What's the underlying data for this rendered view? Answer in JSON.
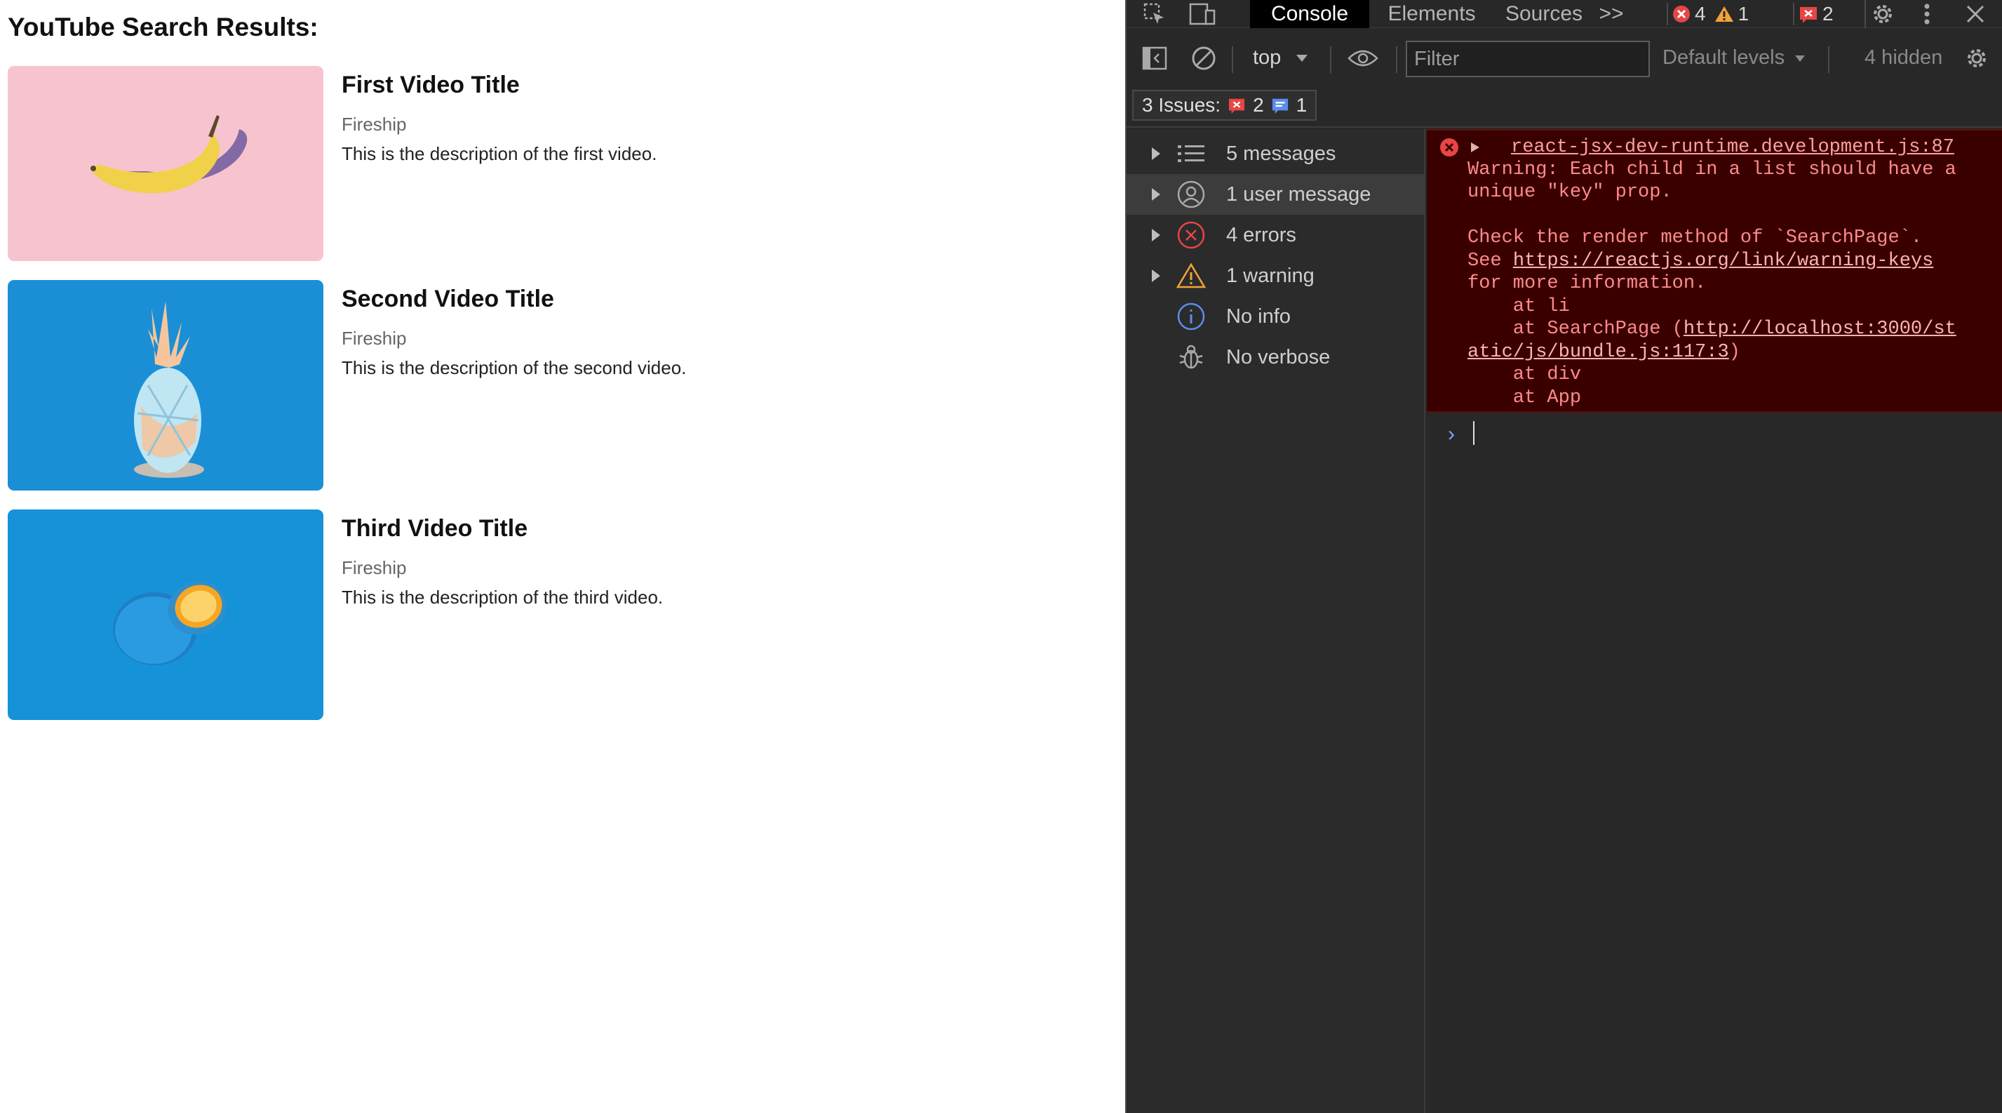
{
  "page": {
    "heading": "YouTube Search Results:",
    "videos": [
      {
        "title": "First Video Title",
        "channel": "Fireship",
        "description": "This is the description of the first video.",
        "thumb_bg": "#f7c3cf"
      },
      {
        "title": "Second Video Title",
        "channel": "Fireship",
        "description": "This is the description of the second video.",
        "thumb_bg": "#1a8fd6"
      },
      {
        "title": "Third Video Title",
        "channel": "Fireship",
        "description": "This is the description of the third video.",
        "thumb_bg": "#1692d8"
      }
    ]
  },
  "devtools": {
    "tabs": {
      "console": "Console",
      "elements": "Elements",
      "sources": "Sources",
      "more": ">>"
    },
    "badges": {
      "errors": "4",
      "warnings": "1",
      "issues": "2"
    },
    "toolbar": {
      "context": "top",
      "filter_placeholder": "Filter",
      "levels": "Default levels",
      "hidden": "4 hidden"
    },
    "issues_bar": {
      "label": "3 Issues:",
      "errors": "2",
      "info": "1"
    },
    "sidebar": [
      {
        "label": "5 messages",
        "icon": "list-icon"
      },
      {
        "label": "1 user message",
        "icon": "user-icon"
      },
      {
        "label": "4 errors",
        "icon": "error-icon"
      },
      {
        "label": "1 warning",
        "icon": "warning-icon"
      },
      {
        "label": "No info",
        "icon": "info-icon"
      },
      {
        "label": "No verbose",
        "icon": "bug-icon"
      }
    ],
    "console": {
      "source": "react-jsx-dev-runtime.development.js:87",
      "line1": "Warning: Each child in a list should have a",
      "line2": "unique \"key\" prop.",
      "line3": "Check the render method of `SearchPage`.",
      "line4_prefix": "See ",
      "line4_link": "https://reactjs.org/link/warning-keys",
      "line5": "for more information.",
      "line6": "    at li",
      "line7_prefix": "    at SearchPage (",
      "line7_link": "http://localhost:3000/st",
      "line8_link": "atic/js/bundle.js:117:3",
      "line8_suffix": ")",
      "line9": "    at div",
      "line10": "    at App"
    },
    "colors": {
      "error": "#e84545",
      "warning": "#f2a33a",
      "info": "#5b8def"
    }
  }
}
